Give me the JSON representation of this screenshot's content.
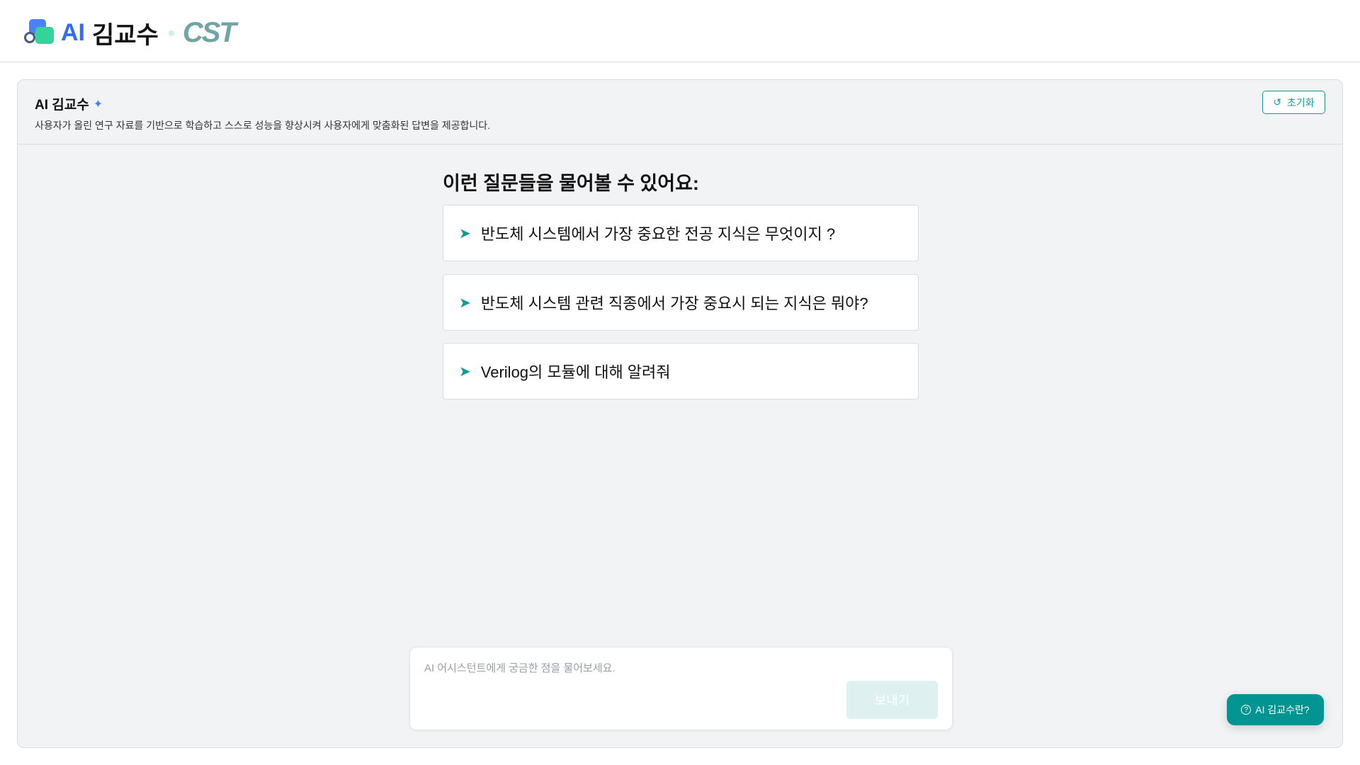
{
  "header": {
    "logo_ai": "AI",
    "logo_name": "김교수",
    "partner_logo": "CST"
  },
  "panel": {
    "title": "AI 김교수",
    "description": "사용자가 올린 연구 자료를 기반으로 학습하고 스스로 성능을 향상시켜 사용자에게 맞춤화된 답변을 제공합니다.",
    "reset_label": "초기화"
  },
  "suggestions": {
    "title": "이런 질문들을 물어볼 수 있어요:",
    "items": [
      {
        "label": "반도체 시스템에서 가장 중요한 전공 지식은 무엇이지 ?"
      },
      {
        "label": "반도체 시스템 관련 직종에서 가장 중요시 되는 지식은 뭐야?"
      },
      {
        "label": "Verilog의 모듈에 대해 알려줘"
      }
    ]
  },
  "chat_input": {
    "placeholder": "AI 어시스턴트에게 궁금한 점을 물어보세요.",
    "value": "",
    "send_label": "보내기"
  },
  "help_button": {
    "label": "AI 김교수란?"
  }
}
